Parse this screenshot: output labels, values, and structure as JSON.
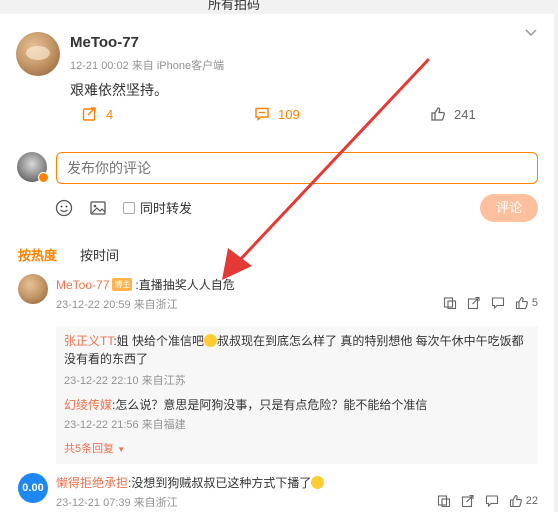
{
  "top_partial_text": "所有拍码",
  "post": {
    "username": "MeToo-77",
    "meta": "12-21 00:02 来自 iPhone客户端",
    "text": "艰难依然坚持。",
    "repost_count": "4",
    "comment_count": "109",
    "like_count": "241"
  },
  "composer": {
    "placeholder": "发布你的评论",
    "repost_label": "同时转发",
    "submit_label": "评论"
  },
  "sort": {
    "hot": "按热度",
    "time": "按时间"
  },
  "comments": [
    {
      "username": "MeToo-77",
      "tag": "博主",
      "text": ":直播抽奖人人自危",
      "meta": "23-12-22 20:59 来自浙江",
      "like_count": "5",
      "replies": [
        {
          "username": "张正义TT",
          "text": ":姐 快给个准信吧",
          "text2": "叔叔现在到底怎么样了 真的特别想他 每次午休中午吃饭都没有看的东西了",
          "meta": "23-12-22 22:10 来自江苏"
        },
        {
          "username": "幻绫传媒",
          "text": ":怎么说？意思是阿狗没事，只是有点危险？能不能给个准信",
          "meta": "23-12-22 21:56 来自福建"
        }
      ],
      "more_replies": "共5条回复"
    },
    {
      "username": "懒得拒绝承担",
      "avatar_text": "0.00",
      "text": ":没想到狗贼叔叔已这种方式下播了",
      "meta": "23-12-21 07:39 来自浙江",
      "like_count": "22"
    }
  ],
  "colors": {
    "accent": "#ff8200",
    "username": "#eb7350",
    "annotation_arrow": "#e53935"
  }
}
